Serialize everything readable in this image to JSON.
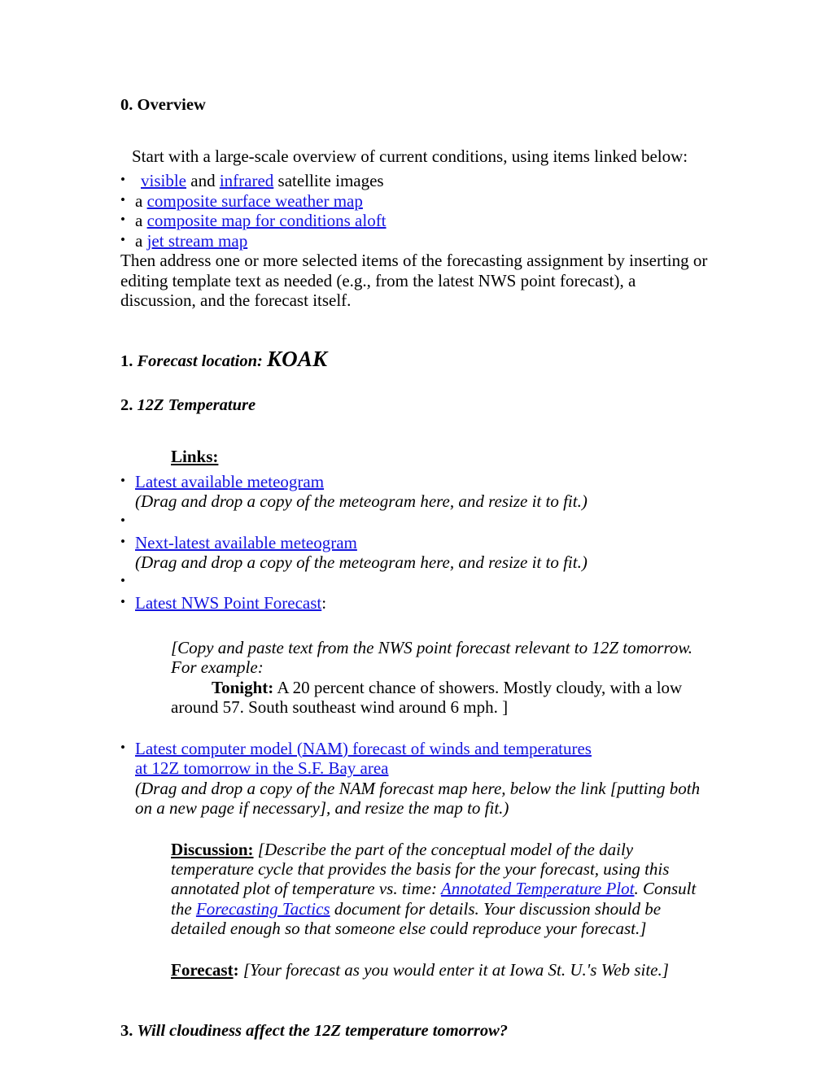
{
  "document": {
    "sections": {
      "overview": {
        "heading": "0. Overview",
        "intro": "Start with a large-scale overview of current conditions, using items linked below:",
        "bullets": [
          {
            "prefix": "",
            "link1": "visible",
            "mid": " and ",
            "link2": "infrared",
            "suffix": " satellite images"
          },
          {
            "prefix": "a ",
            "link1": "composite surface weather map",
            "mid": "",
            "link2": "",
            "suffix": ""
          },
          {
            "prefix": "a ",
            "link1": "composite map for conditions aloft",
            "mid": "",
            "link2": "",
            "suffix": ""
          },
          {
            "prefix": "a ",
            "link1": "jet stream map",
            "mid": "",
            "link2": "",
            "suffix": ""
          }
        ],
        "closing": "Then address one or more selected items of the forecasting assignment by inserting or editing template text as needed (e.g., from the latest NWS point forecast), a discussion, and the forecast itself."
      },
      "forecast_location": {
        "number": "1. ",
        "label": "Forecast location: ",
        "value": "KOAK"
      },
      "temperature": {
        "number": "2. ",
        "label": "12Z Temperature",
        "links_heading": "Links:",
        "links": [
          {
            "link": "Latest available meteogram",
            "trailing": "",
            "note": "(Drag and drop a copy of the meteogram here, and resize it to fit.)"
          },
          {
            "link": "Next-latest available meteogram",
            "trailing": "",
            "note": "(Drag and drop a copy of the meteogram here, and resize it to fit.)"
          },
          {
            "link": "Latest NWS Point Forecast",
            "trailing": ":",
            "note": ""
          }
        ],
        "copy_paste": {
          "line1": "[Copy and paste text from the NWS point forecast relevant to 12Z tomorrow.",
          "line2": "For example:",
          "tonight_label": "Tonight:",
          "tonight_text": " A 20 percent chance of showers. Mostly cloudy, with a low around 57. South southeast wind around 6 mph. ]"
        },
        "nam": {
          "link_line1": "Latest computer model (NAM) forecast of winds and temperatures",
          "link_line2": "at 12Z tomorrow in the S.F. Bay area",
          "note": "(Drag and drop a copy of the NAM forecast map here, below the link [putting both on a new page if necessary], and resize the map to fit.)"
        },
        "discussion": {
          "label": "Discussion:",
          "text_before": " [Describe the part of the conceptual model of the daily temperature cycle that provides the basis for the your forecast, using this annotated plot of temperature vs. time: ",
          "link1": "Annotated Temperature Plot",
          "text_mid": ". Consult the ",
          "link2": "Forecasting Tactics",
          "text_after": " document for details. Your discussion should be detailed enough so that someone else could reproduce your forecast.]"
        },
        "forecast": {
          "label": "Forecast",
          "colon": ":",
          "text": "  [Your forecast as you would enter it at Iowa St. U.'s Web site.]"
        }
      },
      "cloudiness": {
        "number": "3. ",
        "label": "Will cloudiness affect the 12Z temperature tomorrow?"
      }
    },
    "colors": {
      "link": "#1414E0",
      "text": "#000000",
      "background": "#FFFFFF"
    }
  }
}
